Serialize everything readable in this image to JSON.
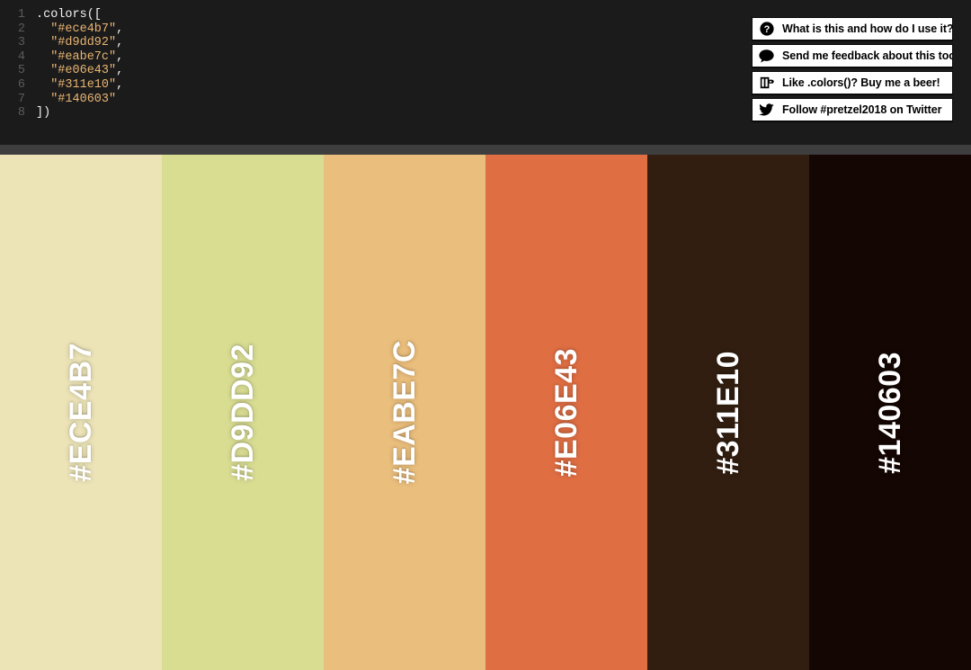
{
  "editor": {
    "language": "javascript",
    "background": "#1b1b1b",
    "gutter_color": "#5a5a5a",
    "string_color": "#e8b473",
    "plain_color": "#f2f2f2",
    "line_numbers": [
      "1",
      "2",
      "3",
      "4",
      "5",
      "6",
      "7",
      "8"
    ],
    "lines": [
      {
        "indent": "",
        "plain": ".colors([",
        "string": "",
        "tail": ""
      },
      {
        "indent": "  ",
        "plain": "",
        "string": "\"#ece4b7\"",
        "tail": ","
      },
      {
        "indent": "  ",
        "plain": "",
        "string": "\"#d9dd92\"",
        "tail": ","
      },
      {
        "indent": "  ",
        "plain": "",
        "string": "\"#eabe7c\"",
        "tail": ","
      },
      {
        "indent": "  ",
        "plain": "",
        "string": "\"#e06e43\"",
        "tail": ","
      },
      {
        "indent": "  ",
        "plain": "",
        "string": "\"#311e10\"",
        "tail": ","
      },
      {
        "indent": "  ",
        "plain": "",
        "string": "\"#140603\"",
        "tail": ""
      },
      {
        "indent": "",
        "plain": "])",
        "string": "",
        "tail": ""
      }
    ]
  },
  "separator": {
    "color": "#3e3e3e"
  },
  "palette": {
    "label_color": "#ffffff",
    "swatches": [
      {
        "label": "#ECE4B7",
        "hex": "#ece4b7"
      },
      {
        "label": "#D9DD92",
        "hex": "#d9dd92"
      },
      {
        "label": "#EABE7C",
        "hex": "#eabe7c"
      },
      {
        "label": "#E06E43",
        "hex": "#e06e43"
      },
      {
        "label": "#311E10",
        "hex": "#311e10"
      },
      {
        "label": "#140603",
        "hex": "#140603"
      }
    ]
  },
  "buttons": [
    {
      "icon": "question-circle-icon",
      "label": "What is this and how do I use it?"
    },
    {
      "icon": "speech-bubble-icon",
      "label": "Send me feedback about this tool!"
    },
    {
      "icon": "beer-mug-icon",
      "label": "Like .colors()? Buy me a beer!"
    },
    {
      "icon": "twitter-bird-icon",
      "label": "Follow #pretzel2018 on Twitter"
    }
  ]
}
